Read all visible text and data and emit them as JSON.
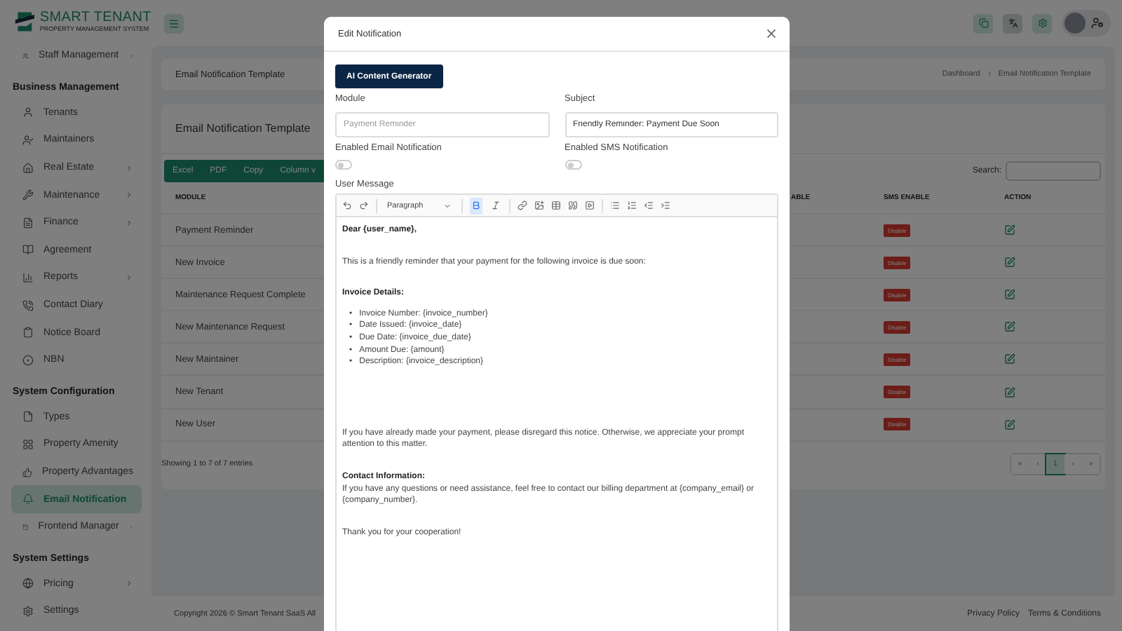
{
  "brand": {
    "name": "SMART TENANT",
    "tagline": "PROPERTY MANAGEMENT SYSTEM"
  },
  "sidebar": {
    "items": [
      {
        "kind": "item",
        "label": "Staff Management",
        "submenu": true,
        "selected": false
      },
      {
        "kind": "header",
        "label": "Business Management"
      },
      {
        "kind": "item",
        "label": "Tenants",
        "submenu": false,
        "selected": false
      },
      {
        "kind": "item",
        "label": "Maintainers",
        "submenu": false,
        "selected": false
      },
      {
        "kind": "item",
        "label": "Real Estate",
        "submenu": true,
        "selected": false
      },
      {
        "kind": "item",
        "label": "Maintenance",
        "submenu": true,
        "selected": false
      },
      {
        "kind": "item",
        "label": "Finance",
        "submenu": true,
        "selected": false
      },
      {
        "kind": "item",
        "label": "Agreement",
        "submenu": false,
        "selected": false
      },
      {
        "kind": "item",
        "label": "Reports",
        "submenu": true,
        "selected": false
      },
      {
        "kind": "item",
        "label": "Contact Diary",
        "submenu": false,
        "selected": false
      },
      {
        "kind": "item",
        "label": "Notice Board",
        "submenu": false,
        "selected": false
      },
      {
        "kind": "item",
        "label": "NBN",
        "submenu": false,
        "selected": false
      },
      {
        "kind": "header",
        "label": "System Configuration"
      },
      {
        "kind": "item",
        "label": "Types",
        "submenu": false,
        "selected": false
      },
      {
        "kind": "item",
        "label": "Property Amenity",
        "submenu": false,
        "selected": false
      },
      {
        "kind": "item",
        "label": "Property Advantages",
        "submenu": false,
        "selected": false
      },
      {
        "kind": "item",
        "label": "Email Notification",
        "submenu": false,
        "selected": true
      },
      {
        "kind": "item",
        "label": "Frontend Manager",
        "submenu": true,
        "selected": false
      },
      {
        "kind": "header",
        "label": "System Settings"
      },
      {
        "kind": "item",
        "label": "Pricing",
        "submenu": true,
        "selected": false
      },
      {
        "kind": "item",
        "label": "Settings",
        "submenu": false,
        "selected": false
      }
    ]
  },
  "page_header": {
    "title": "Email Notification Template",
    "breadcrumb": [
      "Dashboard",
      "Email Notification Template"
    ]
  },
  "card": {
    "title": "Email Notification Template",
    "export_buttons": [
      "Excel",
      "PDF",
      "Copy",
      "Column v"
    ],
    "search": {
      "label": "Search:"
    },
    "columns": [
      "MODULE",
      "ABLE",
      "SMS ENABLE",
      "ACTION"
    ],
    "rows": [
      {
        "module": "Payment Reminder",
        "sms": "Disable"
      },
      {
        "module": "New Invoice",
        "sms": "Disable"
      },
      {
        "module": "Maintenance Request Complete",
        "sms": "Disable"
      },
      {
        "module": "New Maintenance Request",
        "sms": "Disable"
      },
      {
        "module": "New Maintainer",
        "sms": "Disable"
      },
      {
        "module": "New Tenant",
        "sms": "Disable"
      },
      {
        "module": "New User",
        "sms": "Disable"
      }
    ],
    "info": "Showing 1 to 7 of 7 entries",
    "pagination": [
      {
        "label": "«",
        "selected": false
      },
      {
        "label": "‹",
        "selected": false
      },
      {
        "label": "1",
        "selected": true
      },
      {
        "label": "›",
        "selected": false
      },
      {
        "label": "»",
        "selected": false
      }
    ]
  },
  "footer": {
    "copyright": "Copyright 2026 © Smart Tenant SaaS All",
    "links": [
      "Privacy Policy",
      "Terms & Conditions"
    ]
  },
  "modal": {
    "title": "Edit Notification",
    "ai_button": "AI Content Generator",
    "module": {
      "label": "Module",
      "value": "Payment Reminder",
      "disabled": true
    },
    "subject": {
      "label": "Subject",
      "value": "Friendly Reminder: Payment Due Soon",
      "disabled": false
    },
    "email_toggle": {
      "label": "Enabled Email Notification",
      "on": false
    },
    "sms_toggle": {
      "label": "Enabled SMS Notification",
      "on": false
    },
    "message_label": "User Message",
    "editor": {
      "format": "Paragraph",
      "bold_active": true,
      "content": [
        {
          "kind": "bold",
          "text": "Dear {user_name},"
        },
        {
          "kind": "blank"
        },
        {
          "kind": "para",
          "text": "This is a friendly reminder that your payment for the following invoice is due soon:"
        },
        {
          "kind": "blank"
        },
        {
          "kind": "bold",
          "text": "Invoice Details:"
        },
        {
          "kind": "list",
          "marker": "•",
          "items": [
            "Invoice Number: {invoice_number}",
            "Date Issued: {invoice_date}",
            "Due Date: {invoice_due_date}",
            "Amount Due: {amount}",
            "Description: {invoice_description}"
          ]
        },
        {
          "kind": "blank"
        },
        {
          "kind": "blank"
        },
        {
          "kind": "blank"
        },
        {
          "kind": "para",
          "text": "If you have already made your payment, please disregard this notice. Otherwise, we appreciate your prompt attention to this matter."
        },
        {
          "kind": "blank"
        },
        {
          "kind": "bold",
          "text": "Contact Information:"
        },
        {
          "kind": "para",
          "text": "If you have any questions or need assistance, feel free to contact our billing department at {company_email} or {company_number}."
        },
        {
          "kind": "blank"
        },
        {
          "kind": "para",
          "text": "Thank you for your cooperation!"
        }
      ]
    }
  }
}
